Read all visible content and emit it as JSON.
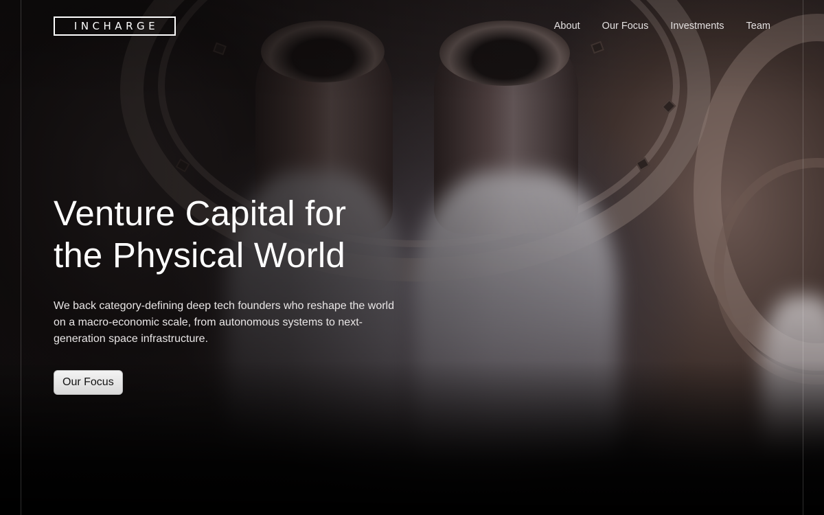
{
  "brand": {
    "logo_text": "INCHARGE"
  },
  "nav": {
    "items": [
      {
        "label": "About"
      },
      {
        "label": "Our Focus"
      },
      {
        "label": "Investments"
      },
      {
        "label": "Team"
      }
    ]
  },
  "hero": {
    "title_line1": "Venture Capital for",
    "title_line2": "the Physical World",
    "subtitle": "We back category-defining deep tech founders who reshape the world on a macro-economic scale, from autonomous systems to next-generation space infrastructure.",
    "cta_label": "Our Focus"
  },
  "colors": {
    "background": "#0b0909",
    "text": "#ffffff",
    "button_bg": "#e6e6e6"
  }
}
